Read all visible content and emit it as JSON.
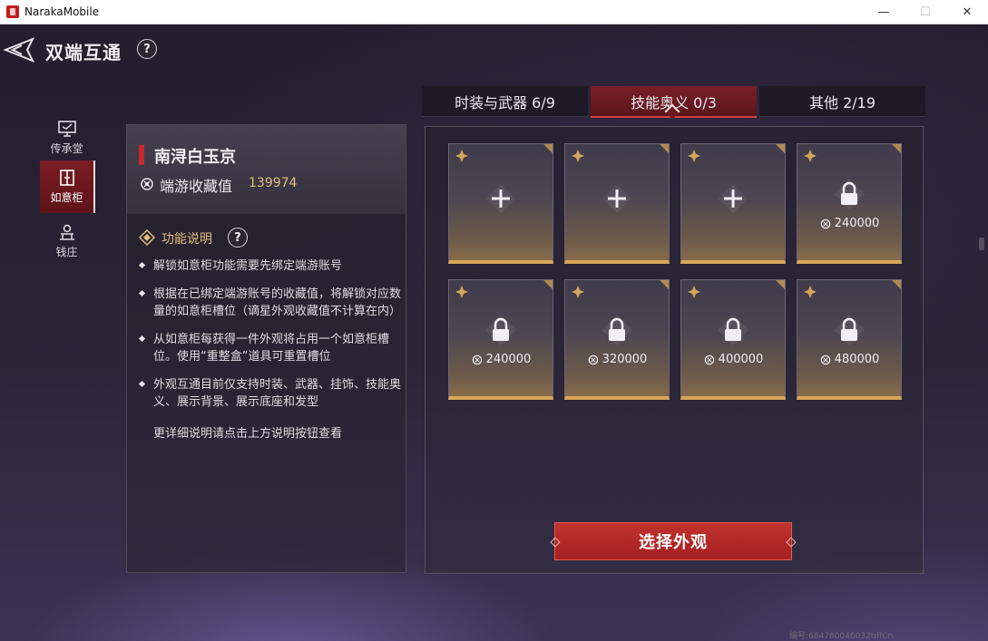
{
  "window": {
    "title": "NarakaMobile",
    "controls": [
      "—",
      "☐",
      "✕"
    ]
  },
  "header": {
    "title": "双端互通",
    "help": "?"
  },
  "nav": {
    "items": [
      {
        "label": "传承堂",
        "icon": "monitor-icon",
        "active": false
      },
      {
        "label": "如意柜",
        "icon": "cabinet-icon",
        "active": true
      },
      {
        "label": "钱庄",
        "icon": "bank-icon",
        "active": false
      }
    ]
  },
  "info": {
    "name": "南浔白玉京",
    "collection_label": "端游收藏值",
    "collection_value": "139974",
    "func_title": "功能说明",
    "bullets": [
      "解锁如意柜功能需要先绑定端游账号",
      "根据在已绑定端游账号的收藏值，将解锁对应数量的如意柜槽位（谪星外观收藏值不计算在内）",
      "从如意柜每获得一件外观将占用一个如意柜槽位。使用“重整盒”道具可重置槽位",
      "外观互通目前仅支持时装、武器、挂饰、技能奥义、展示背景、展示底座和发型"
    ],
    "note": "更详细说明请点击上方说明按钮查看"
  },
  "tabs": [
    {
      "label": "时装与武器  6/9",
      "active": false
    },
    {
      "label": "技能奥义  0/3",
      "active": true
    },
    {
      "label": "其他  2/19",
      "active": false
    }
  ],
  "slots": [
    {
      "state": "empty",
      "price": ""
    },
    {
      "state": "empty",
      "price": ""
    },
    {
      "state": "empty",
      "price": ""
    },
    {
      "state": "locked",
      "price": "240000"
    },
    {
      "state": "locked",
      "price": "240000"
    },
    {
      "state": "locked",
      "price": "320000"
    },
    {
      "state": "locked",
      "price": "400000"
    },
    {
      "state": "locked",
      "price": "480000"
    }
  ],
  "select_button": "选择外观",
  "watermark": "编号:684780046032tdfCn",
  "colors": {
    "accent_red": "#c2322e",
    "gold": "#e2bc79",
    "slot_border": "#d6a657"
  }
}
